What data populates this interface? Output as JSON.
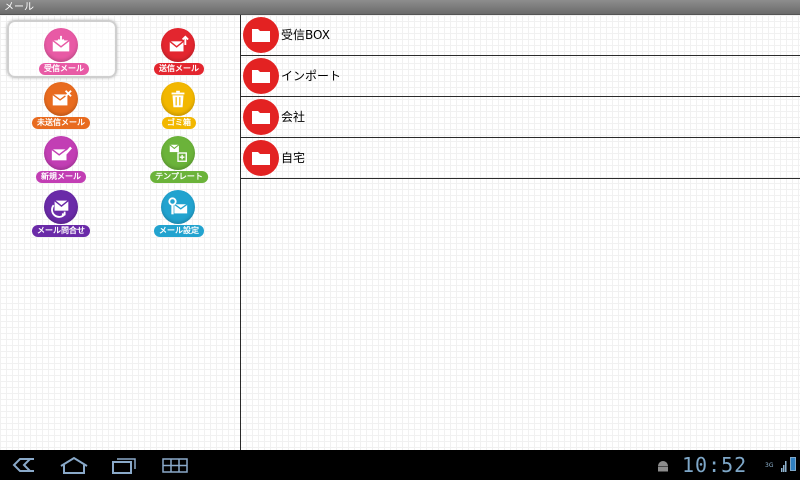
{
  "app": {
    "title": "メール"
  },
  "menu": [
    {
      "label": "受信メール",
      "icon": "inbox-mail-icon",
      "color": "#e85aa5",
      "selected": true
    },
    {
      "label": "送信メール",
      "icon": "sent-mail-icon",
      "color": "#e3262f",
      "selected": false
    },
    {
      "label": "未送信メール",
      "icon": "unsent-mail-icon",
      "color": "#e86b1f",
      "selected": false
    },
    {
      "label": "ゴミ箱",
      "icon": "trash-icon",
      "color": "#f2b700",
      "selected": false
    },
    {
      "label": "新規メール",
      "icon": "new-mail-icon",
      "color": "#c23eb4",
      "selected": false
    },
    {
      "label": "テンプレート",
      "icon": "template-icon",
      "color": "#6bb33a",
      "selected": false
    },
    {
      "label": "メール問合せ",
      "icon": "mail-inquiry-icon",
      "color": "#6a2aa8",
      "selected": false
    },
    {
      "label": "メール設定",
      "icon": "mail-settings-icon",
      "color": "#22a3cf",
      "selected": false
    }
  ],
  "folders": [
    {
      "label": "受信BOX"
    },
    {
      "label": "インポート"
    },
    {
      "label": "会社"
    },
    {
      "label": "自宅"
    }
  ],
  "folder_color": "#e32222",
  "status": {
    "time": "10:52",
    "network": "3G"
  },
  "navbar": {
    "back": "back-icon",
    "home": "home-icon",
    "recent": "recent-apps-icon",
    "menu": "menu-grid-icon"
  }
}
